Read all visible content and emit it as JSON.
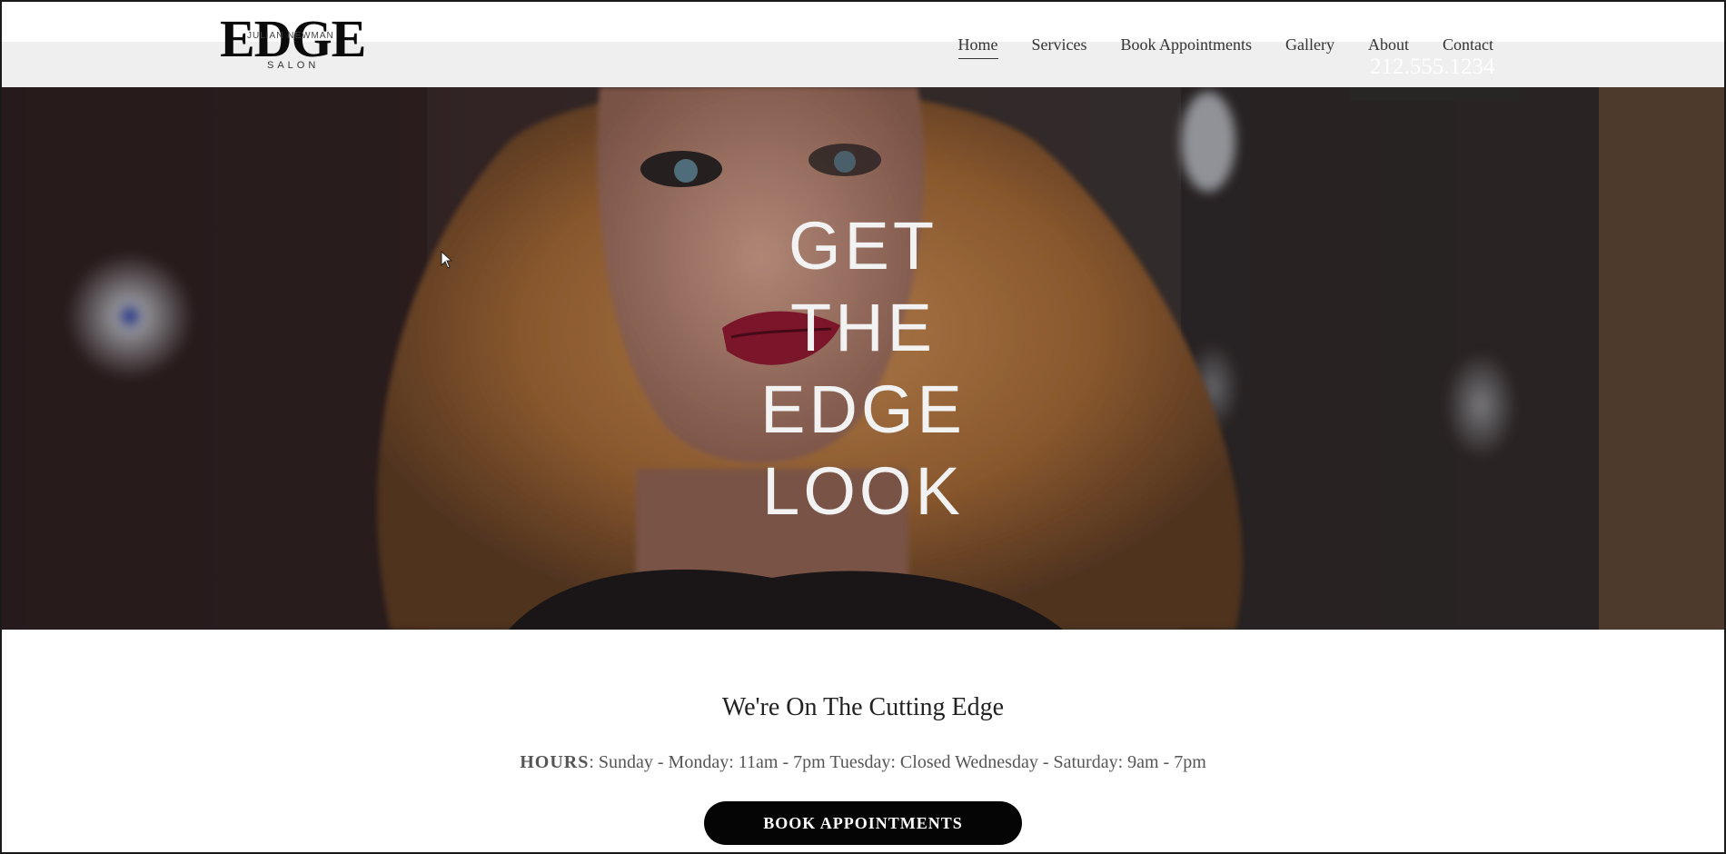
{
  "logo": {
    "main": "EDGE",
    "overlay": "JULIAN NEWMAN",
    "sub": "SALON"
  },
  "nav": [
    {
      "label": "Home",
      "active": true
    },
    {
      "label": "Services",
      "active": false
    },
    {
      "label": "Book Appointments",
      "active": false
    },
    {
      "label": "Gallery",
      "active": false
    },
    {
      "label": "About",
      "active": false
    },
    {
      "label": "Contact",
      "active": false
    }
  ],
  "phone": "212.555.1234",
  "hero": {
    "lines": [
      "GET",
      "THE",
      "EDGE",
      "LOOK"
    ]
  },
  "section": {
    "title": "We're On The Cutting Edge",
    "hours_label": "HOURS",
    "hours_text": ":  Sunday - Monday: 11am - 7pm  Tuesday: Closed  Wednesday - Saturday: 9am - 7pm"
  },
  "cta": {
    "label": "BOOK APPOINTMENTS"
  },
  "colors": {
    "button_bg": "#050505",
    "hero_text": "#f2f2f2",
    "header_band": "#efefef"
  }
}
